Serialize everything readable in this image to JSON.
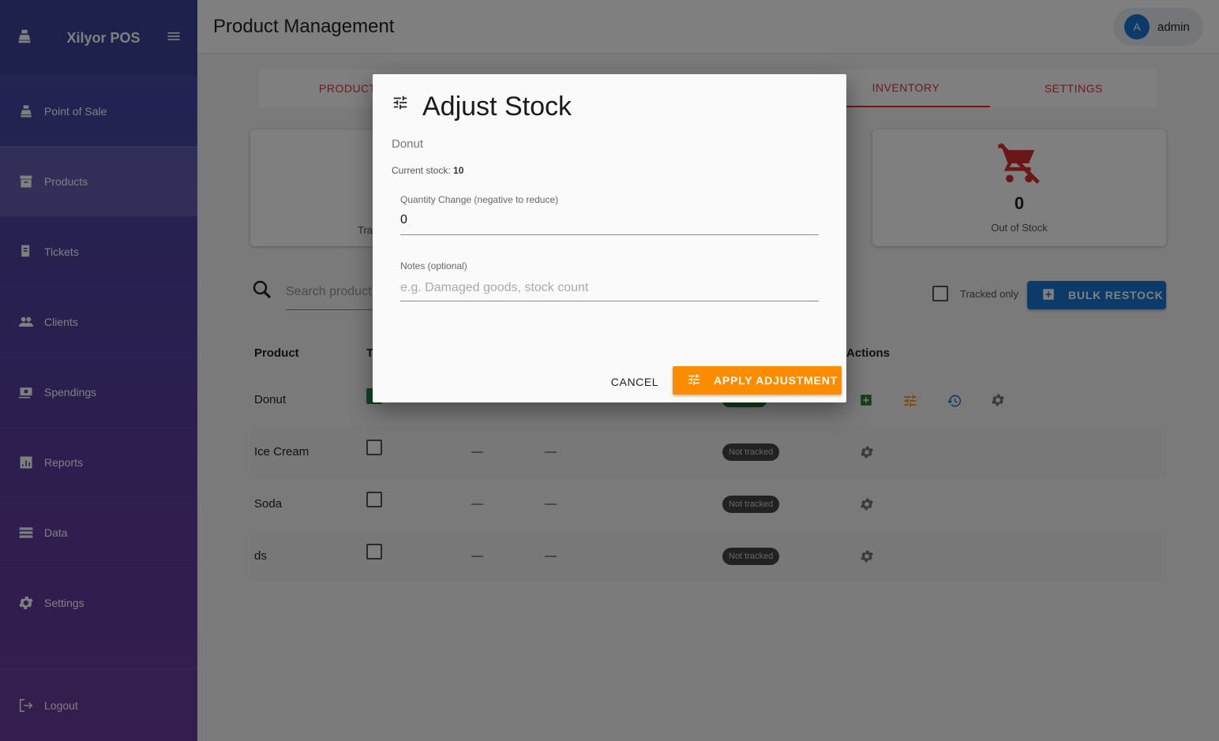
{
  "app": {
    "name": "Xilyor POS"
  },
  "sidebar": {
    "items": [
      {
        "label": "Point of Sale",
        "icon": "cash-register-icon"
      },
      {
        "label": "Products",
        "icon": "archive-icon"
      },
      {
        "label": "Tickets",
        "icon": "receipt-icon"
      },
      {
        "label": "Clients",
        "icon": "people-icon"
      },
      {
        "label": "Spendings",
        "icon": "money-icon"
      },
      {
        "label": "Reports",
        "icon": "bar-chart-icon"
      },
      {
        "label": "Data",
        "icon": "database-icon"
      },
      {
        "label": "Settings",
        "icon": "gear-icon"
      }
    ],
    "active": "Products",
    "logout_label": "Logout"
  },
  "header": {
    "title": "Product Management",
    "user": {
      "initial": "A",
      "name": "admin"
    }
  },
  "tabs": [
    {
      "label": "PRODUCT"
    },
    {
      "label": "INVENTORY"
    },
    {
      "label": "SETTINGS"
    }
  ],
  "stats": {
    "left_card_label": "Tra",
    "out_of_stock": {
      "value": "0",
      "label": "Out of Stock"
    }
  },
  "search": {
    "placeholder": "Search product"
  },
  "filters": {
    "tracked_only_label": "Tracked only"
  },
  "bulk_restock_label": "BULK RESTOCK",
  "table": {
    "headers": {
      "product": "Product",
      "tracked": "T",
      "actions": "Actions"
    },
    "rows": [
      {
        "product": "Donut",
        "tracked": true
      },
      {
        "product": "Ice Cream",
        "tracked": false,
        "dash1": "—",
        "dash2": "—",
        "status": "Not tracked"
      },
      {
        "product": "Soda",
        "tracked": false,
        "dash1": "—",
        "dash2": "—",
        "status": "Not tracked"
      },
      {
        "product": "ds",
        "tracked": false,
        "dash1": "—",
        "dash2": "—",
        "status": "Not tracked"
      }
    ]
  },
  "dialog": {
    "title": "Adjust Stock",
    "product": "Donut",
    "current_stock_label": "Current stock:",
    "current_stock_value": "10",
    "quantity_label": "Quantity Change (negative to reduce)",
    "quantity_value": "0",
    "notes_label": "Notes (optional)",
    "notes_placeholder": "e.g. Damaged goods, stock count",
    "cancel_label": "CANCEL",
    "apply_label": "APPLY ADJUSTMENT"
  },
  "colors": {
    "primary": "#1976d2",
    "accent": "#fb8c00",
    "tab": "#d33333",
    "danger": "#d32f2f"
  }
}
